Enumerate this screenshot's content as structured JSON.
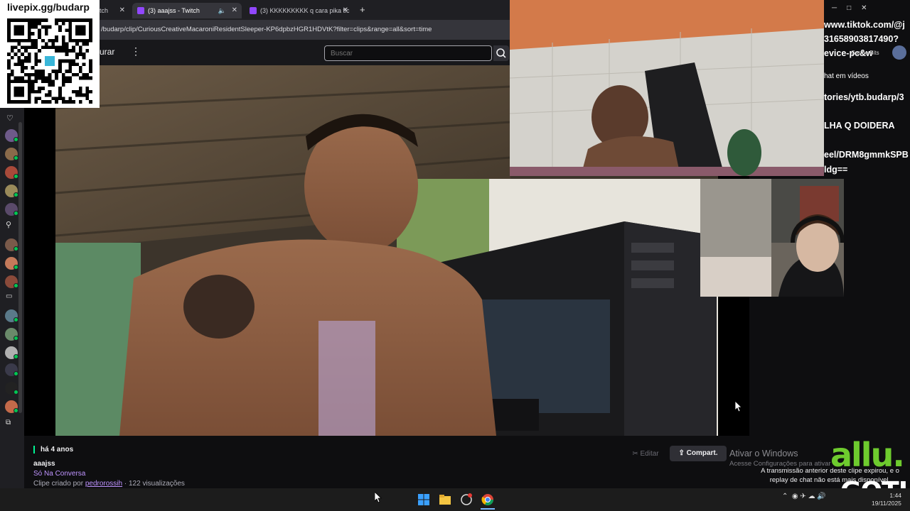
{
  "qr": {
    "label": "livepix.gg/budarp"
  },
  "browser": {
    "tabs": [
      {
        "label": "tch"
      },
      {
        "label": "(3) aaajss - Twitch",
        "active": true
      },
      {
        "label": "(3) KKKKKKKKK q cara pika tic"
      }
    ],
    "new_tab": "+",
    "url": "/budarp/clip/CuriousCreativeMacaroniResidentSleeper-KP6dpbzHGR1HDVtK?filter=clips&range=all&sort=time"
  },
  "twitch": {
    "browse_label": "urar",
    "more": "⋮",
    "search_placeholder": "Buscar",
    "clip": {
      "time_ago": "há 4 anos",
      "channel": "aaajss",
      "category": "Só Na Conversa",
      "creator_prefix": "Clipe criado por",
      "creator": "pedrorossih",
      "views": "· 122 visualizações"
    },
    "edit_label": "Editar",
    "share_label": "Compart.",
    "replay_note": "A transmissão anterior deste clipe expirou, e o replay de chat não está mais disponível."
  },
  "overlay_text": {
    "lines": [
      "www.tiktok.com/@j",
      "31658903817490?",
      "evice-pc&w",
      "hat em vídeos",
      "tories/ytb.budarp/3",
      "LHA Q DOIDERA",
      "eel/DRM8gmmkSPB",
      "ldg=="
    ],
    "bits_label": "Ganhe Bits"
  },
  "windows": {
    "activate_title": "Ativar o Windows",
    "activate_sub": "Acesse Configurações para ativar",
    "clock_time": "1:44",
    "clock_date": "19/11/2025"
  },
  "logos": {
    "allu": "allu.",
    "goti": "GOTI"
  },
  "colors": {
    "twitch_purple": "#9147ff",
    "live_green": "#00f593",
    "allu_green": "#6ecb2e"
  }
}
